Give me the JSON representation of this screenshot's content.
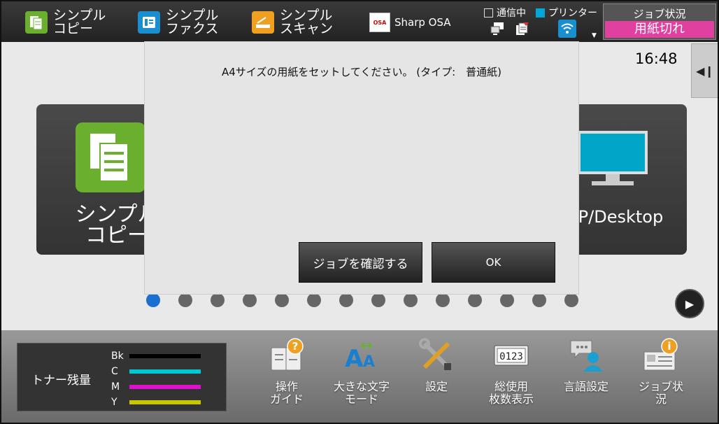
{
  "topbar": {
    "apps": [
      {
        "label": "シンプル\nコピー",
        "icon": "copy-icon",
        "color": "#6ab02e"
      },
      {
        "label": "シンプル\nファクス",
        "icon": "fax-icon",
        "color": "#1a8fd0"
      },
      {
        "label": "シンプル\nスキャン",
        "icon": "scan-icon",
        "color": "#f0a020"
      }
    ],
    "osa": {
      "label": "Sharp OSA",
      "logo": "OSA"
    },
    "status": {
      "communicating": "通信中",
      "printer": "プリンター"
    },
    "job_status": {
      "title": "ジョブ状況",
      "error": "用紙切れ"
    }
  },
  "main": {
    "clock": "16:48",
    "tiles": [
      {
        "label": "シンプル\nコピー"
      },
      {
        "label": "TP/Desktop"
      }
    ]
  },
  "dialog": {
    "message": "A4サイズの用紙をセットしてください。 (タイプ:　普通紙)",
    "confirm_label": "ジョブを確認する",
    "ok_label": "OK"
  },
  "bottom": {
    "toner": {
      "title": "トナー残量",
      "rows": [
        {
          "key": "Bk",
          "color": "#000000"
        },
        {
          "key": "C",
          "color": "#00c8d0"
        },
        {
          "key": "M",
          "color": "#e010d0"
        },
        {
          "key": "Y",
          "color": "#c8c800"
        }
      ]
    },
    "items": [
      {
        "label": "操作\nガイド"
      },
      {
        "label": "大きな文字\nモード"
      },
      {
        "label": "設定"
      },
      {
        "label": "総使用\n枚数表示",
        "counter": "0123"
      },
      {
        "label": "言語設定"
      },
      {
        "label": "ジョブ状\n況"
      }
    ]
  }
}
